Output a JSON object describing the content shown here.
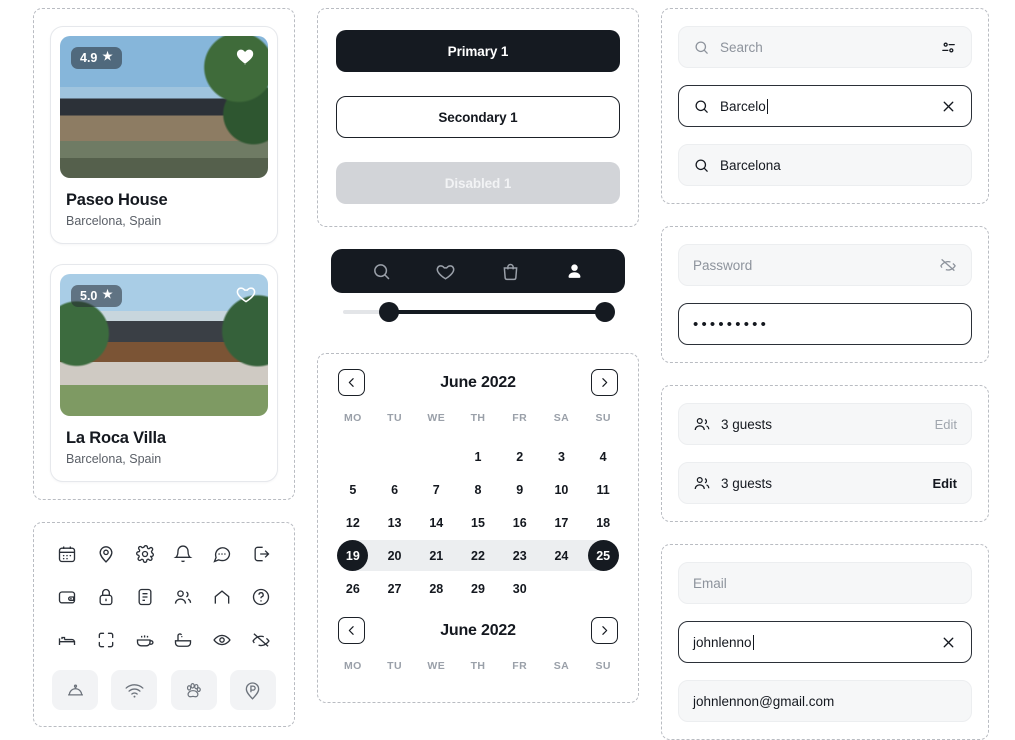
{
  "properties": {
    "cards": [
      {
        "rating": "4.9",
        "star": "★",
        "title": "Paseo House",
        "location": "Barcelona, Spain",
        "favorite": "filled",
        "heart_icon": "heart-filled-icon"
      },
      {
        "rating": "5.0",
        "star": "★",
        "title": "La Roca Villa",
        "location": "Barcelona, Spain",
        "favorite": "outline",
        "heart_icon": "heart-outline-icon"
      }
    ]
  },
  "icon_grid": {
    "rows": [
      [
        "calendar-icon",
        "location-pin-icon",
        "settings-gear-icon",
        "bell-icon",
        "chat-bubble-icon",
        "logout-icon"
      ],
      [
        "wallet-icon",
        "lock-icon",
        "document-icon",
        "users-icon",
        "home-icon",
        "help-circle-icon"
      ],
      [
        "bed-icon",
        "scan-frame-icon",
        "coffee-cup-icon",
        "bathtub-icon",
        "eye-icon",
        "eye-off-icon"
      ]
    ],
    "chips": [
      "room-service-icon",
      "wifi-icon",
      "paw-icon",
      "parking-icon"
    ]
  },
  "buttons": {
    "primary": "Primary 1",
    "secondary": "Secondary 1",
    "disabled": "Disabled 1"
  },
  "tabbar": {
    "items": [
      {
        "icon": "search-icon",
        "active": false
      },
      {
        "icon": "heart-icon",
        "active": false
      },
      {
        "icon": "bag-icon",
        "active": false
      },
      {
        "icon": "person-icon",
        "active": true
      }
    ]
  },
  "slider": {
    "min_percent": 17,
    "max_percent": 97
  },
  "calendars": [
    {
      "title": "June 2022",
      "prev_icon": "chevron-left-icon",
      "next_icon": "chevron-right-icon",
      "weekdays": [
        "MO",
        "TU",
        "WE",
        "TH",
        "FR",
        "SA",
        "SU"
      ],
      "lead_blanks": 3,
      "days": [
        1,
        2,
        3,
        4,
        5,
        6,
        7,
        8,
        9,
        10,
        11,
        12,
        13,
        14,
        15,
        16,
        17,
        18,
        19,
        20,
        21,
        22,
        23,
        24,
        25,
        26,
        27,
        28,
        29,
        30
      ],
      "range_start": 19,
      "range_end": 25
    },
    {
      "title": "June 2022",
      "prev_icon": "chevron-left-icon",
      "next_icon": "chevron-right-icon",
      "weekdays": [
        "MO",
        "TU",
        "WE",
        "TH",
        "FR",
        "SA",
        "SU"
      ]
    }
  ],
  "search": {
    "empty": {
      "placeholder": "Search",
      "icon": "search-icon",
      "trailing_icon": "filter-sliders-icon"
    },
    "active": {
      "value": "Barcelo",
      "icon": "search-icon",
      "trailing_icon": "close-x-icon"
    },
    "result": {
      "value": "Barcelona",
      "icon": "search-icon"
    }
  },
  "password": {
    "empty": {
      "placeholder": "Password",
      "trailing_icon": "eye-off-icon"
    },
    "filled": {
      "value": "•••••••••"
    }
  },
  "guests": {
    "rows": [
      {
        "icon": "users-icon",
        "label": "3 guests",
        "action": "Edit",
        "emphasis": "muted"
      },
      {
        "icon": "users-icon",
        "label": "3 guests",
        "action": "Edit",
        "emphasis": "strong"
      }
    ]
  },
  "email": {
    "empty": {
      "placeholder": "Email"
    },
    "active": {
      "value": "johnlenno",
      "trailing_icon": "close-x-icon"
    },
    "result": {
      "value": "johnlennon@gmail.com"
    }
  }
}
